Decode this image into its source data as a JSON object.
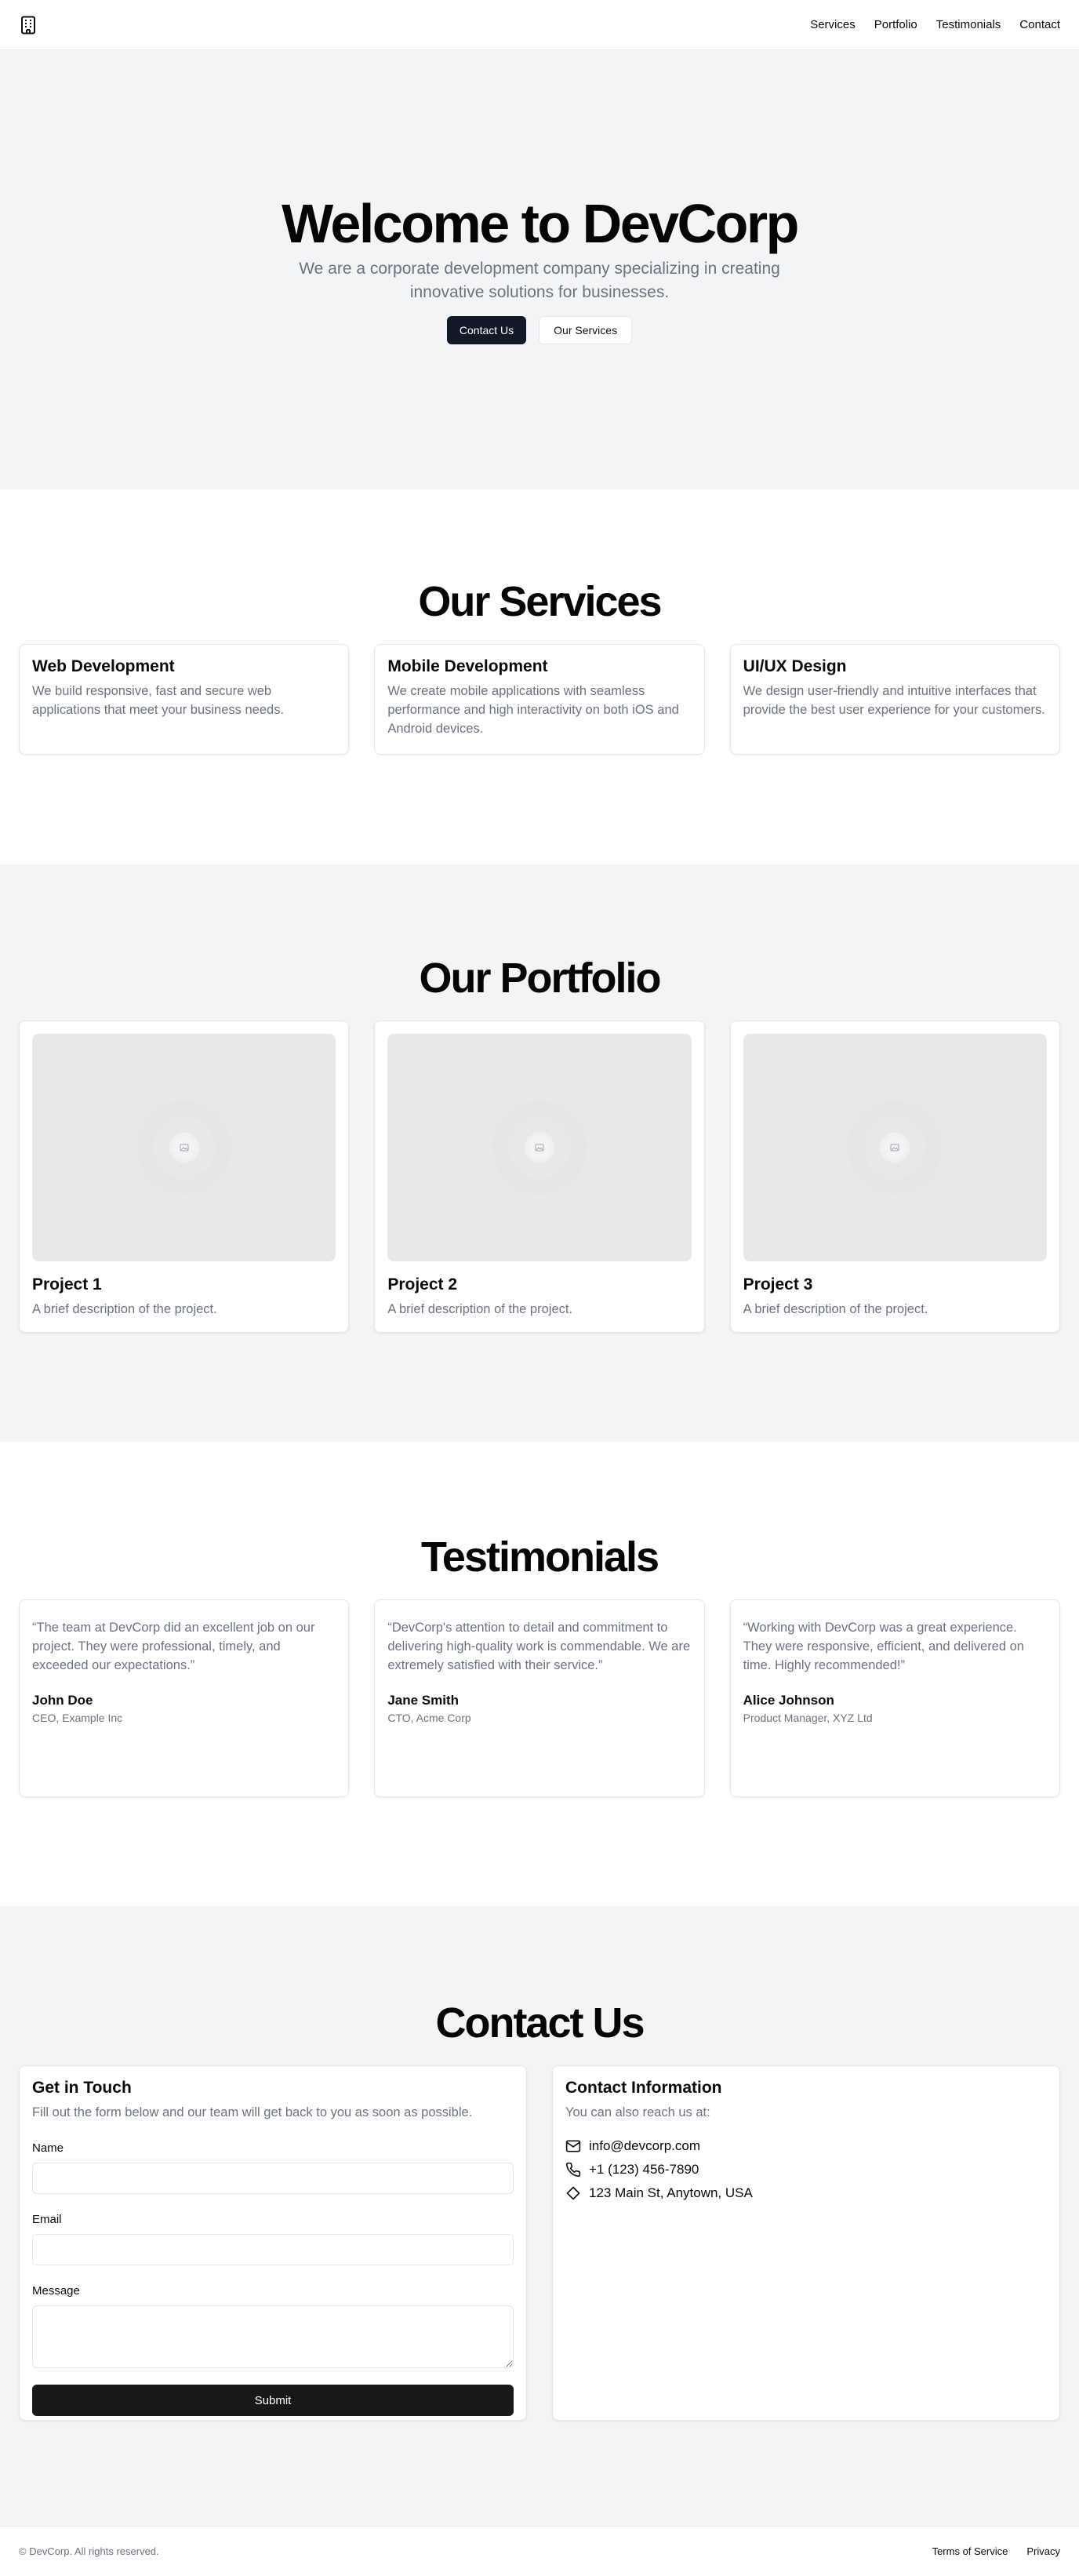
{
  "nav": {
    "logo_icon": "building-icon",
    "links": [
      "Services",
      "Portfolio",
      "Testimonials",
      "Contact"
    ]
  },
  "hero": {
    "title": "Welcome to DevCorp",
    "subtitle": "We are a corporate development company specializing in creating innovative solutions for businesses.",
    "primary_button": "Contact Us",
    "secondary_button": "Our Services"
  },
  "services": {
    "heading": "Our Services",
    "items": [
      {
        "title": "Web Development",
        "desc": "We build responsive, fast and secure web applications that meet your business needs."
      },
      {
        "title": "Mobile Development",
        "desc": "We create mobile applications with seamless performance and high interactivity on both iOS and Android devices."
      },
      {
        "title": "UI/UX Design",
        "desc": "We design user-friendly and intuitive interfaces that provide the best user experience for your customers."
      }
    ]
  },
  "portfolio": {
    "heading": "Our Portfolio",
    "image_icon": "image-placeholder-icon",
    "items": [
      {
        "title": "Project 1",
        "desc": "A brief description of the project."
      },
      {
        "title": "Project 2",
        "desc": "A brief description of the project."
      },
      {
        "title": "Project 3",
        "desc": "A brief description of the project."
      }
    ]
  },
  "testimonials": {
    "heading": "Testimonials",
    "items": [
      {
        "quote": "“The team at DevCorp did an excellent job on our project. They were professional, timely, and exceeded our expectations.”",
        "name": "John Doe",
        "role": "CEO, Example Inc"
      },
      {
        "quote": "“DevCorp's attention to detail and commitment to delivering high-quality work is commendable. We are extremely satisfied with their service.”",
        "name": "Jane Smith",
        "role": "CTO, Acme Corp"
      },
      {
        "quote": "“Working with DevCorp was a great experience. They were responsive, efficient, and delivered on time. Highly recommended!”",
        "name": "Alice Johnson",
        "role": "Product Manager, XYZ Ltd"
      }
    ]
  },
  "contact": {
    "heading": "Contact Us",
    "form": {
      "title": "Get in Touch",
      "subtitle": "Fill out the form below and our team will get back to you as soon as possible.",
      "name_label": "Name",
      "email_label": "Email",
      "message_label": "Message",
      "name_value": "",
      "email_value": "",
      "message_value": "",
      "submit_label": "Submit"
    },
    "info": {
      "title": "Contact Information",
      "subtitle": "You can also reach us at:",
      "email": "info@devcorp.com",
      "phone": "+1 (123) 456-7890",
      "address": "123 Main St, Anytown, USA",
      "email_icon": "mail-icon",
      "phone_icon": "phone-icon",
      "address_icon": "location-icon"
    }
  },
  "footer": {
    "copyright": "© DevCorp. All rights reserved.",
    "links": [
      "Terms of Service",
      "Privacy"
    ]
  },
  "colors": {
    "primary_button": "#111827",
    "section_bg": "#f3f4f6",
    "muted_text": "#6b7280"
  }
}
